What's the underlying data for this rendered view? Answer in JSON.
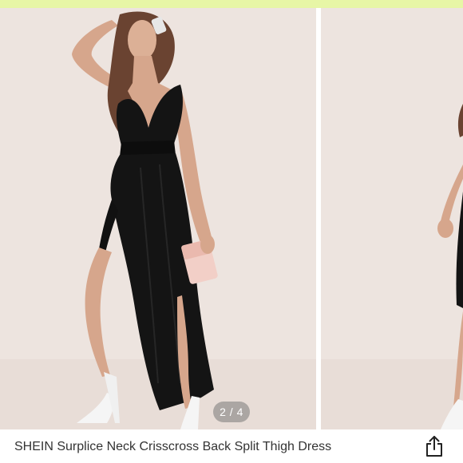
{
  "colors": {
    "top_strip": "#e7f6a6",
    "photo_background": "#ede4df",
    "dress": "#111111",
    "clutch": "#f2cfc7",
    "title_text": "#333333"
  },
  "gallery": {
    "current_page": 2,
    "total_pages": 4,
    "indicator_label": "2 / 4",
    "main_image": {
      "subject": "model-in-black-maxi-dress"
    },
    "next_image": {
      "subject": "model-in-black-maxi-dress-partial"
    }
  },
  "product": {
    "title": "SHEIN Surplice Neck Crisscross Back Split Thigh Dress"
  },
  "actions": {
    "share_icon": "share-icon"
  }
}
